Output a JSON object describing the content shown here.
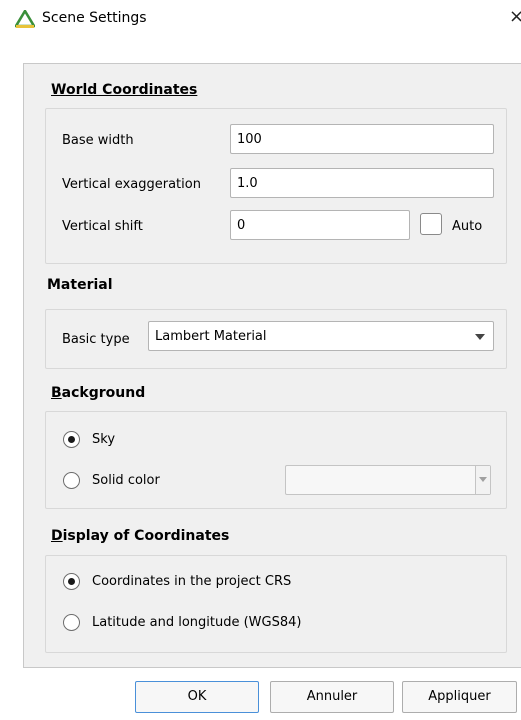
{
  "window": {
    "title": "Scene Settings",
    "close_glyph": "×",
    "app_icon": "qgis-triangle-icon",
    "icon_color": "#3a8f3a"
  },
  "world": {
    "title_underlined": "W",
    "title_rest": "orld Coordinates",
    "base_width_label": "Base width",
    "base_width_value": "100",
    "vertical_exaggeration_label": "Vertical exaggeration",
    "vertical_exaggeration_value": "1.0",
    "vertical_shift_label": "Vertical shift",
    "vertical_shift_value": "0",
    "auto_label": "Auto",
    "auto_checked": false
  },
  "material": {
    "title": "Material",
    "basic_type_label": "Basic type",
    "basic_type_value": "Lambert Material"
  },
  "background": {
    "title_underlined": "B",
    "title_rest": "ackground",
    "sky_label": "Sky",
    "sky_selected": true,
    "solid_color_label": "Solid color",
    "solid_color_selected": false
  },
  "display": {
    "title_underlined": "D",
    "title_rest": "isplay of Coordinates",
    "project_crs_label": "Coordinates in the project CRS",
    "project_crs_selected": true,
    "latlon_label": "Latitude and longitude (WGS84)",
    "latlon_selected": false
  },
  "buttons": {
    "ok": "OK",
    "cancel": "Annuler",
    "apply": "Appliquer"
  }
}
